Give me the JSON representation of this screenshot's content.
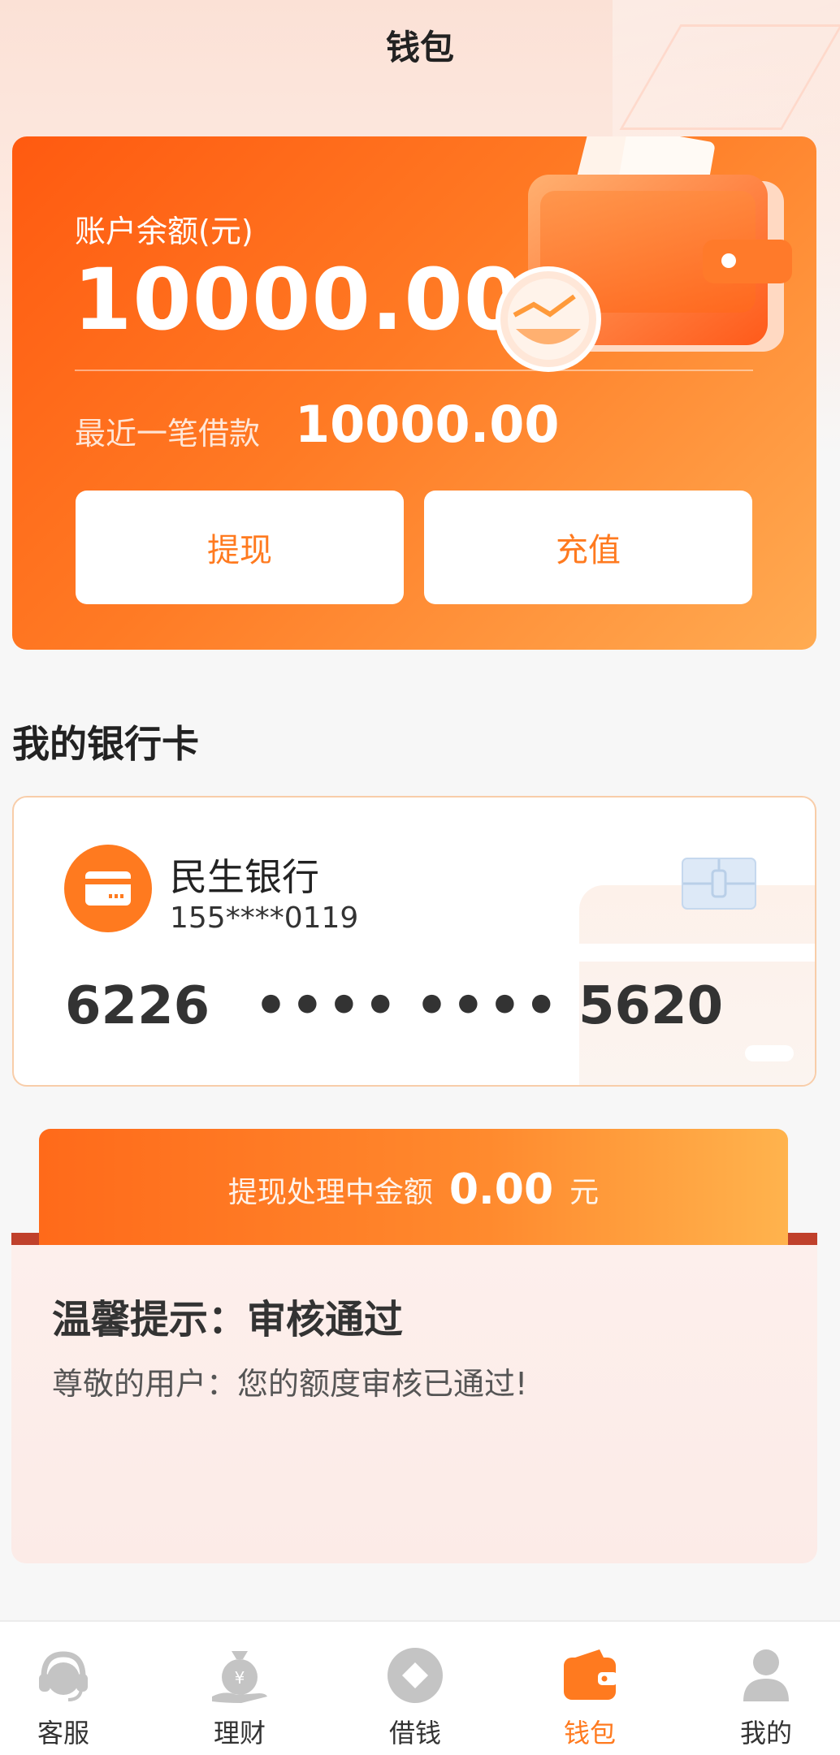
{
  "header": {
    "title": "钱包"
  },
  "balance": {
    "label": "账户余额(元)",
    "amount": "10000.00",
    "recent_label": "最近一笔借款",
    "recent_amount": "10000.00",
    "withdraw_label": "提现",
    "recharge_label": "充值"
  },
  "bank_section": {
    "title": "我的银行卡",
    "card": {
      "bank_name": "民生银行",
      "phone": "155****0119",
      "num_part1": "6226",
      "num_part2": "••••",
      "num_part3": "••••",
      "num_part4": "5620",
      "logo_icon": "bank-card-icon",
      "chip_icon": "card-chip-icon"
    }
  },
  "processing": {
    "label": "提现处理中金额",
    "amount": "0.00",
    "unit": "元"
  },
  "notice": {
    "title": "温馨提示：审核通过",
    "text": "尊敬的用户：您的额度审核已通过!"
  },
  "tabbar": {
    "items": [
      {
        "label": "客服",
        "icon": "customer-service-icon",
        "active": false
      },
      {
        "label": "理财",
        "icon": "money-bag-icon",
        "active": false
      },
      {
        "label": "借钱",
        "icon": "borrow-diamond-icon",
        "active": false
      },
      {
        "label": "钱包",
        "icon": "wallet-icon",
        "active": true
      },
      {
        "label": "我的",
        "icon": "user-icon",
        "active": false
      }
    ]
  },
  "colors": {
    "accent": "#ff7a1f",
    "accent_dark": "#ff5a10",
    "accent_light": "#ffab52",
    "inactive_icon": "#c4c4c4"
  }
}
